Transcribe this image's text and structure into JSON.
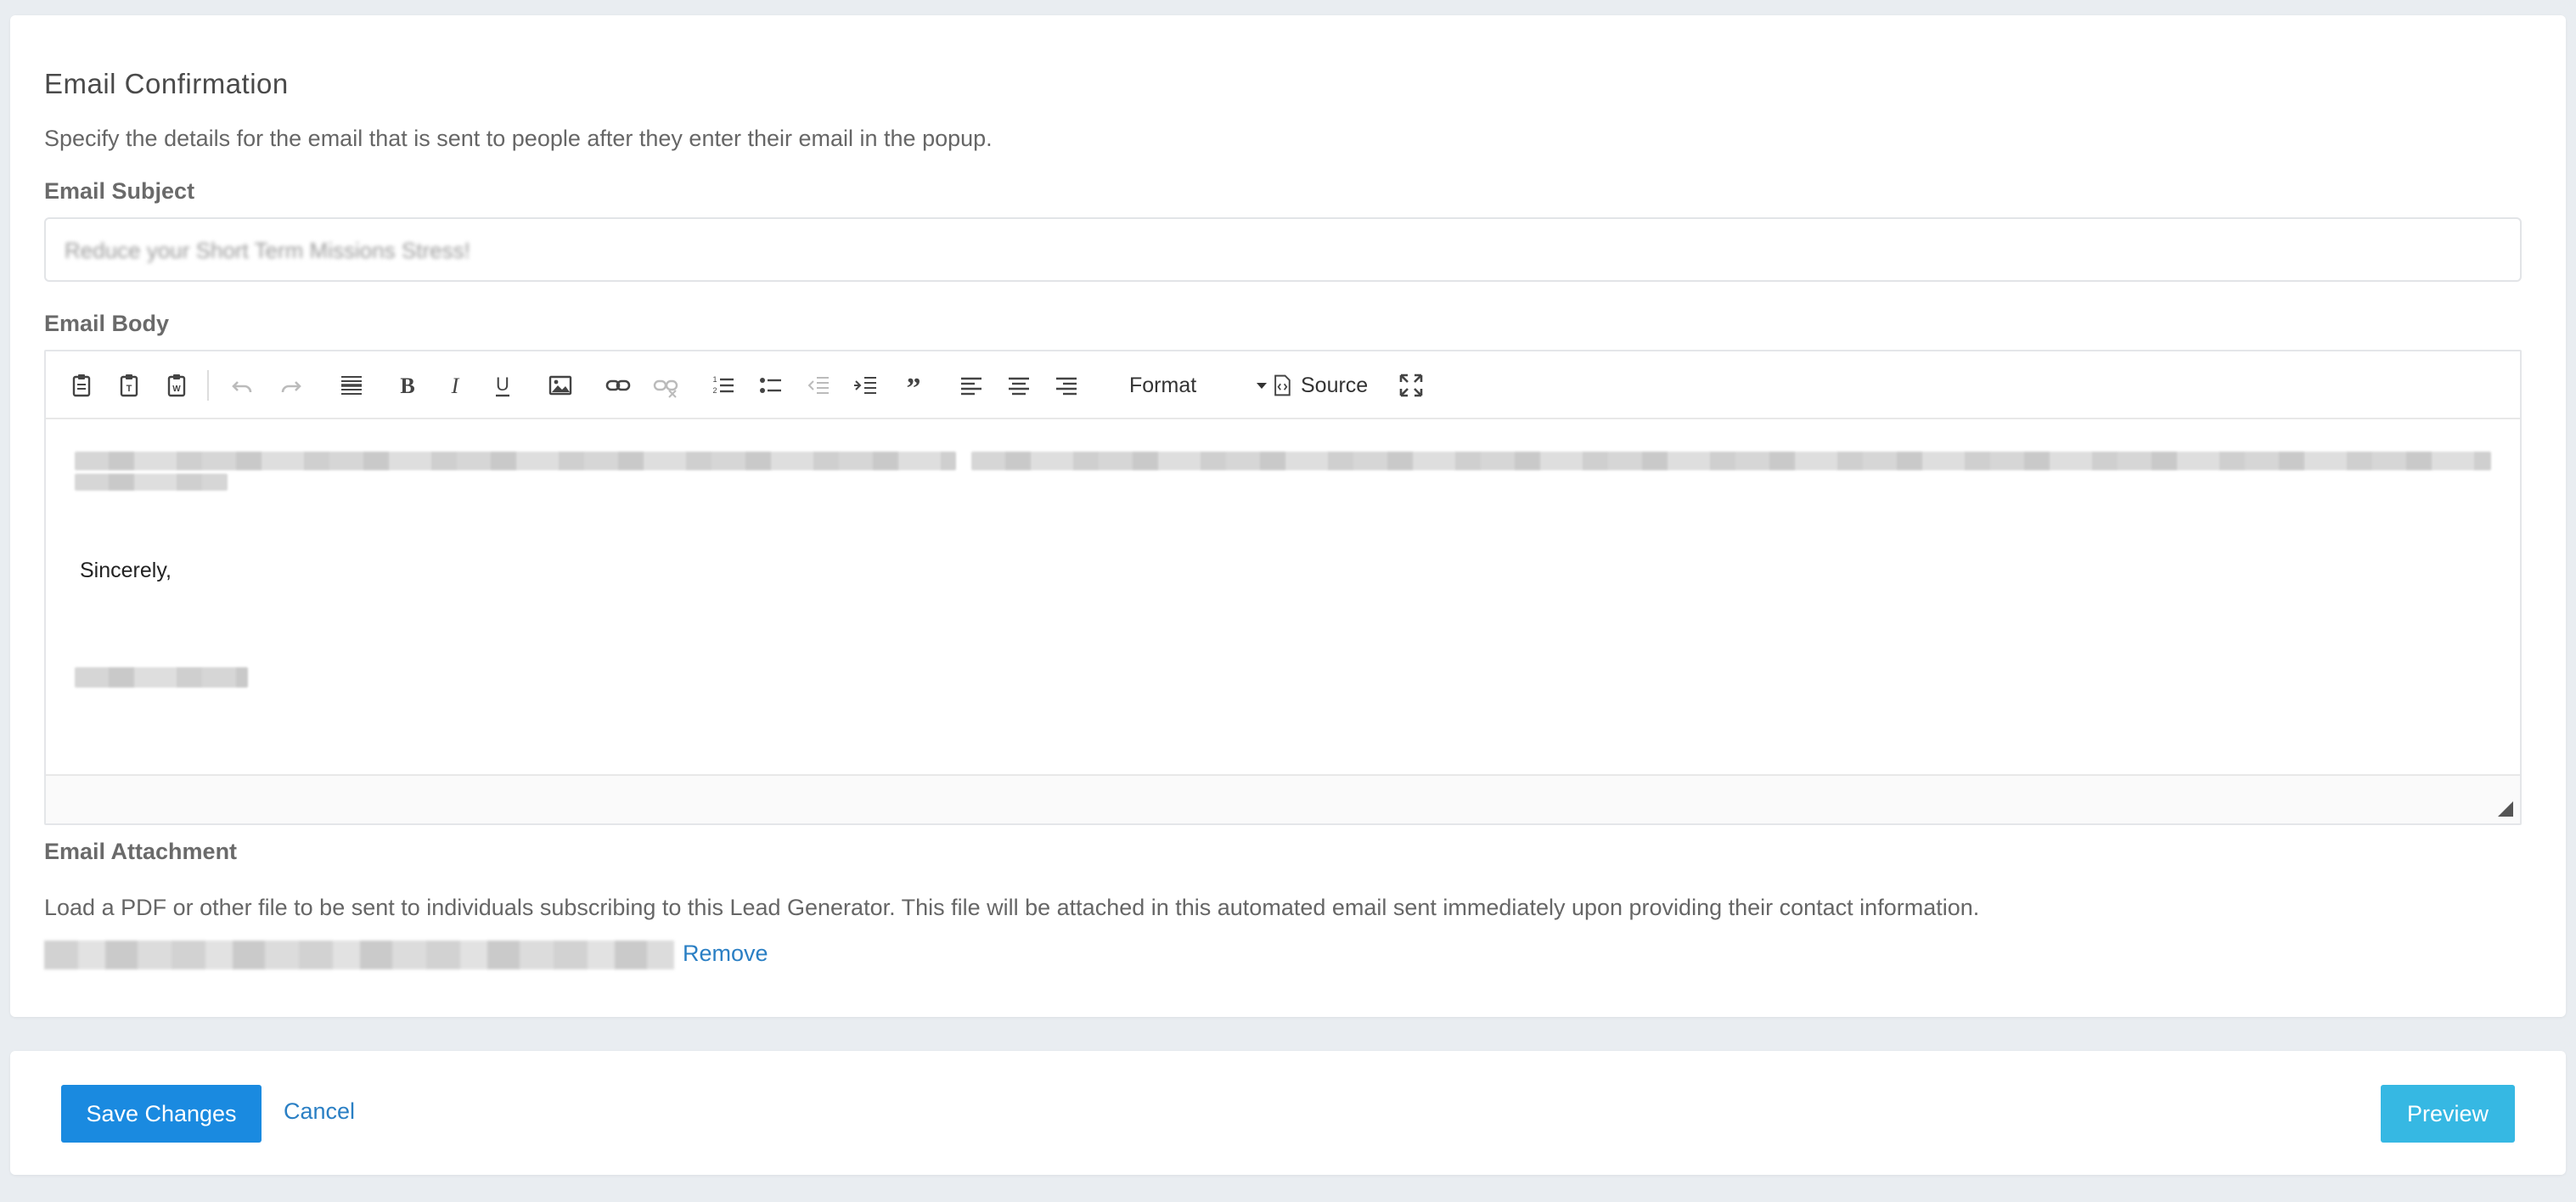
{
  "section": {
    "title": "Email Confirmation",
    "description": "Specify the details for the email that is sent to people after they enter their email in the popup."
  },
  "subject": {
    "label": "Email Subject",
    "value": "Reduce your Short Term Missions Stress!"
  },
  "body": {
    "label": "Email Body",
    "format_label": "Format",
    "source_label": "Source",
    "sincerely": "Sincerely,"
  },
  "attachment": {
    "label": "Email Attachment",
    "description": "Load a PDF or other file to be sent to individuals subscribing to this Lead Generator. This file will be attached in this automated email sent immediately upon providing their contact information.",
    "remove_label": "Remove"
  },
  "footer": {
    "save_label": "Save Changes",
    "cancel_label": "Cancel",
    "preview_label": "Preview"
  },
  "toolbar_icons": [
    "paste-icon",
    "paste-text-icon",
    "paste-word-icon",
    "undo-icon",
    "redo-icon",
    "horizontal-rule-icon",
    "bold-icon",
    "italic-icon",
    "underline-icon",
    "image-icon",
    "link-icon",
    "unlink-icon",
    "numbered-list-icon",
    "bulleted-list-icon",
    "outdent-icon",
    "indent-icon",
    "blockquote-icon",
    "align-left-icon",
    "align-center-icon",
    "align-right-icon",
    "source-icon",
    "maximize-icon"
  ],
  "colors": {
    "primary": "#1a8ae0",
    "info": "#36b8e3",
    "link": "#2a7fc4",
    "background": "#e9edf1"
  }
}
